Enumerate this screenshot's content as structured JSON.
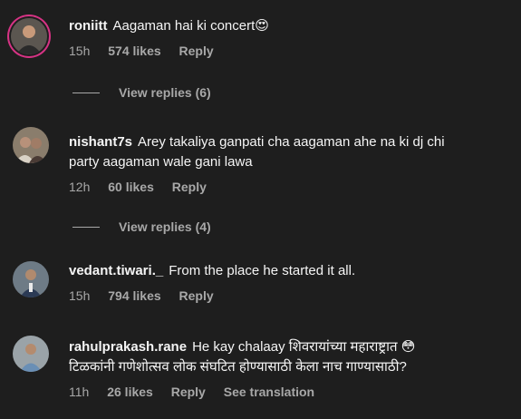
{
  "comments": [
    {
      "username": "roniitt",
      "text": "Aagaman hai ki concert",
      "emoji": "😍",
      "time": "15h",
      "likes": "574 likes",
      "reply": "Reply",
      "view_replies": "View replies (6)"
    },
    {
      "username": "nishant7s",
      "text_line1": "Arey takaliya ganpati cha aagaman ahe na ki dj chi",
      "text_line2": "party aagaman wale gani lawa",
      "time": "12h",
      "likes": "60 likes",
      "reply": "Reply",
      "view_replies": "View replies (4)"
    },
    {
      "username": "vedant.tiwari._",
      "text": "From the place he started it all.",
      "time": "15h",
      "likes": "794 likes",
      "reply": "Reply"
    },
    {
      "username": "rahulprakash.rane",
      "text_line1": "He kay chalaay शिवरायांच्या महाराष्ट्रात",
      "emoji": "😳",
      "text_line2": "टिळकांनी गणेशोत्सव लोक संघटित होण्यासाठी केला नाच गाण्यासाठी?",
      "time": "11h",
      "likes": "26 likes",
      "reply": "Reply",
      "see_translation": "See translation"
    }
  ],
  "colors": {
    "background": "#1e1e1e",
    "primary_text": "#f5f5f5",
    "secondary_text": "#a8a8a8",
    "story_ring": "#d63384"
  }
}
